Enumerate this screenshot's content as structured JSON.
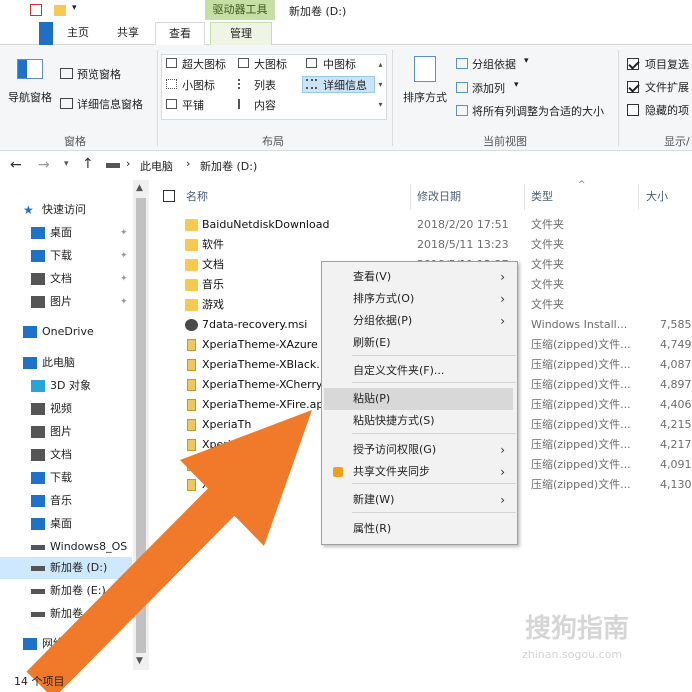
{
  "window": {
    "title": "新加卷 (D:)",
    "context_tab": "驱动器工具"
  },
  "tabs": {
    "home": "主页",
    "share": "共享",
    "view": "查看",
    "manage": "管理"
  },
  "ribbon": {
    "nav_pane": "导航窗格",
    "preview_pane": "预览窗格",
    "details_pane": "详细信息窗格",
    "group_panes": "窗格",
    "layouts": [
      "超大图标",
      "大图标",
      "中图标",
      "小图标",
      "列表",
      "详细信息",
      "平铺",
      "内容"
    ],
    "group_layout": "布局",
    "sort_by": "排序方式",
    "group_by": "分组依据",
    "add_columns": "添加列",
    "fit_columns": "将所有列调整为合适的大小",
    "group_current_view": "当前视图",
    "item_checkboxes": "项目复选",
    "file_extensions": "文件扩展",
    "hidden_items": "隐藏的项",
    "group_show": "显示/"
  },
  "address": {
    "crumbs": [
      "此电脑",
      "新加卷 (D:)"
    ],
    "separator": "›"
  },
  "nav": [
    {
      "label": "快速访问",
      "icon": "star-icon",
      "color": "#1f72c9"
    },
    {
      "label": "桌面",
      "icon": "desktop-icon",
      "color": "#1f72c9"
    },
    {
      "label": "下载",
      "icon": "download-icon",
      "color": "#1f72c9"
    },
    {
      "label": "文档",
      "icon": "document-icon",
      "color": "#555555"
    },
    {
      "label": "图片",
      "icon": "picture-icon",
      "color": "#555555"
    },
    {
      "label": "OneDrive",
      "icon": "cloud-icon",
      "color": "#1f72c9"
    },
    {
      "label": "此电脑",
      "icon": "computer-icon",
      "color": "#1f72c9"
    },
    {
      "label": "3D 对象",
      "icon": "cube-icon",
      "color": "#29a4d6"
    },
    {
      "label": "视频",
      "icon": "video-icon",
      "color": "#555555"
    },
    {
      "label": "图片",
      "icon": "picture-icon",
      "color": "#555555"
    },
    {
      "label": "文档",
      "icon": "document-icon",
      "color": "#555555"
    },
    {
      "label": "下载",
      "icon": "download-icon",
      "color": "#1f72c9"
    },
    {
      "label": "音乐",
      "icon": "music-icon",
      "color": "#1f72c9"
    },
    {
      "label": "桌面",
      "icon": "desktop-icon",
      "color": "#1f72c9"
    },
    {
      "label": "Windows8_OS",
      "icon": "drive-icon",
      "color": "#555555"
    },
    {
      "label": "新加卷 (D:)",
      "icon": "drive-icon",
      "color": "#555555"
    },
    {
      "label": "新加卷 (E:)",
      "icon": "drive-icon",
      "color": "#555555"
    },
    {
      "label": "新加卷 (F",
      "icon": "drive-icon",
      "color": "#555555"
    },
    {
      "label": "网络",
      "icon": "network-icon",
      "color": "#1f72c9"
    }
  ],
  "columns": {
    "name": "名称",
    "date": "修改日期",
    "type": "类型",
    "size": "大小"
  },
  "files": [
    {
      "name": "BaiduNetdiskDownload",
      "date": "2018/2/20 17:51",
      "type": "文件夹",
      "size": "",
      "kind": "folder"
    },
    {
      "name": "软件",
      "date": "2018/5/11 13:23",
      "type": "文件夹",
      "size": "",
      "kind": "folder"
    },
    {
      "name": "文档",
      "date": "2018/5/11 13:27",
      "type": "文件夹",
      "size": "",
      "kind": "folder"
    },
    {
      "name": "音乐",
      "date": "",
      "type": "文件夹",
      "size": "",
      "kind": "folder"
    },
    {
      "name": "游戏",
      "date": "",
      "type": "文件夹",
      "size": "",
      "kind": "folder"
    },
    {
      "name": "7data-recovery.msi",
      "date": "",
      "type": "Windows Install...",
      "size": "7,585",
      "kind": "msi"
    },
    {
      "name": "XperiaTheme-XAzure",
      "date": "",
      "type": "压缩(zipped)文件...",
      "size": "4,749",
      "kind": "zip"
    },
    {
      "name": "XperiaTheme-XBlack.",
      "date": "",
      "type": "压缩(zipped)文件...",
      "size": "4,087",
      "kind": "zip"
    },
    {
      "name": "XperiaTheme-XCherry",
      "date": "",
      "type": "压缩(zipped)文件...",
      "size": "4,897",
      "kind": "zip"
    },
    {
      "name": "XperiaTheme-XFire.ap",
      "date": "",
      "type": "压缩(zipped)文件...",
      "size": "4,406",
      "kind": "zip"
    },
    {
      "name": "XperiaTh",
      "date": "",
      "type": "压缩(zipped)文件...",
      "size": "4,215",
      "kind": "zip"
    },
    {
      "name": "XperiaTh",
      "date": "",
      "type": "压缩(zipped)文件...",
      "size": "4,217",
      "kind": "zip"
    },
    {
      "name": "Xperia",
      "date": "",
      "type": "压缩(zipped)文件...",
      "size": "4,091",
      "kind": "zip"
    },
    {
      "name": "Xp",
      "date": "",
      "type": "压缩(zipped)文件...",
      "size": "4,130",
      "kind": "zip"
    }
  ],
  "context_menu": [
    {
      "label": "查看(V)",
      "arrow": "›"
    },
    {
      "label": "排序方式(O)",
      "arrow": "›"
    },
    {
      "label": "分组依据(P)",
      "arrow": "›"
    },
    {
      "label": "刷新(E)",
      "arrow": ""
    },
    {
      "label": "自定义文件夹(F)...",
      "arrow": ""
    },
    {
      "label": "粘贴(P)",
      "arrow": ""
    },
    {
      "label": "粘贴快捷方式(S)",
      "arrow": ""
    },
    {
      "label": "授予访问权限(G)",
      "arrow": "›"
    },
    {
      "label": "共享文件夹同步",
      "arrow": "›"
    },
    {
      "label": "新建(W)",
      "arrow": "›"
    },
    {
      "label": "属性(R)",
      "arrow": ""
    }
  ],
  "status": {
    "text": "14 个项目"
  },
  "watermark": {
    "main": "搜狗指南",
    "sub": "zhinan.sogou.com"
  },
  "colors": {
    "accent": "#1f72c9",
    "arrow": "#f07a2a",
    "selection": "#cde8ff"
  }
}
